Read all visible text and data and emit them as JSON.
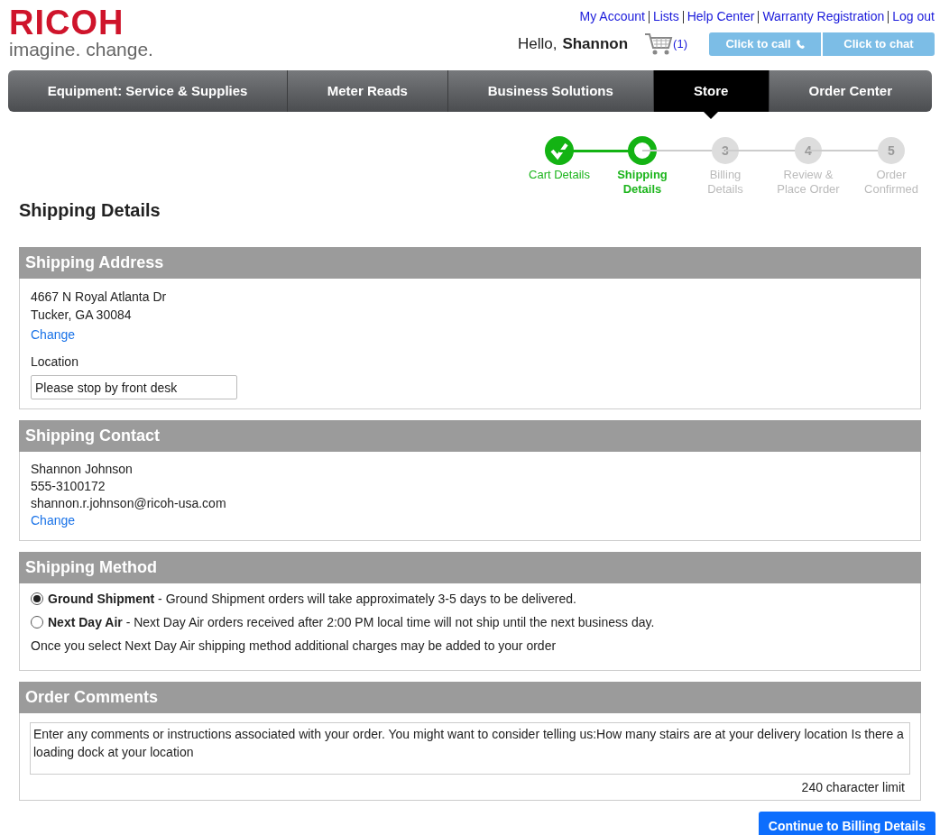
{
  "header": {
    "logo": "RICOH",
    "tagline": "imagine. change.",
    "links": [
      "My Account",
      "Lists",
      "Help Center",
      "Warranty Registration",
      "Log out"
    ],
    "greeting": "Hello,",
    "user": "Shannon",
    "cart_count": "(1)",
    "call_button": "Click to call",
    "chat_button": "Click to chat"
  },
  "nav": [
    {
      "label": "Equipment: Service & Supplies",
      "selected": false
    },
    {
      "label": "Meter Reads",
      "selected": false
    },
    {
      "label": "Business Solutions",
      "selected": false
    },
    {
      "label": "Store",
      "selected": true
    },
    {
      "label": "Order Center",
      "selected": false
    }
  ],
  "steps": [
    {
      "kind": "done",
      "label": "Cart Details"
    },
    {
      "kind": "current",
      "label": "Shipping Details"
    },
    {
      "kind": "todo",
      "number": "3",
      "label": "Billing Details"
    },
    {
      "kind": "todo",
      "number": "4",
      "label": "Review & Place Order"
    },
    {
      "kind": "todo",
      "number": "5",
      "label": "Order Confirmed"
    }
  ],
  "page_title": "Shipping Details",
  "shipping_address": {
    "title": "Shipping Address",
    "lines": [
      "4667 N Royal Atlanta Dr",
      "Tucker, GA 30084"
    ],
    "change": "Change",
    "location_label": "Location",
    "location_value": "Please stop by front desk"
  },
  "shipping_contact": {
    "title": "Shipping Contact",
    "lines": [
      "Shannon Johnson",
      "555-3100172",
      "shannon.r.johnson@ricoh-usa.com"
    ],
    "change": "Change"
  },
  "shipping_method": {
    "title": "Shipping Method",
    "options": [
      {
        "name": "Ground Shipment",
        "description": " - Ground Shipment orders will take approximately 3-5 days to be delivered.",
        "selected": true
      },
      {
        "name": "Next Day Air",
        "description": " - Next Day Air orders received after 2:00 PM local time will not ship until the next business day.",
        "selected": false
      }
    ],
    "note": "Once you select Next Day Air shipping method additional charges may be added to your order"
  },
  "order_comments": {
    "title": "Order Comments",
    "placeholder": "Enter any comments or instructions associated with your order. You might want to consider telling us:How many stairs are at your delivery location Is there a loading dock at your location",
    "limit": "240 character limit"
  },
  "continue_button": "Continue to Billing Details"
}
